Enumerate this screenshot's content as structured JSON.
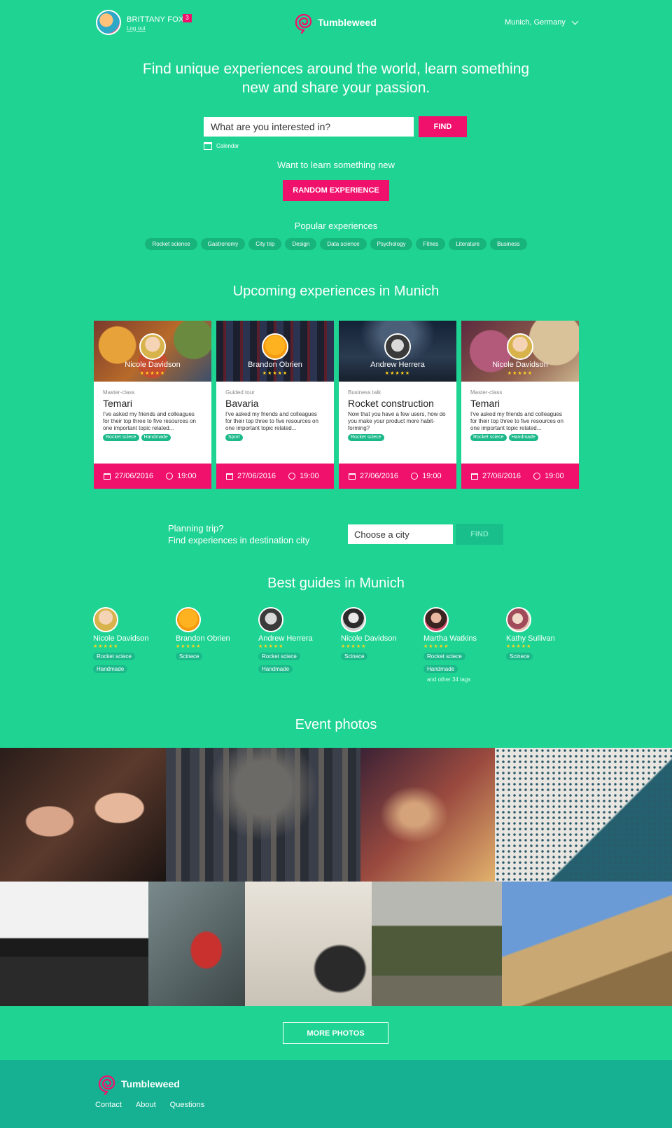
{
  "header": {
    "user_name": "BRITTANY FOX",
    "logout": "Log out",
    "notifications": "3",
    "brand": "Tumbleweed",
    "location": "Munich, Germany"
  },
  "hero": {
    "title": "Find unique experiences around the world, learn something new and share your passion.",
    "search_placeholder": "What are you interested in?",
    "find_label": "FIND",
    "calendar_label": "Calendar",
    "learn_text": "Want to learn something new",
    "random_label": "RANDOM EXPERIENCE",
    "popular_title": "Popular experiences",
    "tags": [
      "Rocket science",
      "Gastronomy",
      "City trip",
      "Design",
      "Data science",
      "Psychology",
      "Fitnes",
      "Literature",
      "Business"
    ]
  },
  "upcoming": {
    "title": "Upcoming experiences in Munich",
    "stars": "★★★★★",
    "cards": [
      {
        "host": "Nicole Davidson",
        "category": "Master-class",
        "title": "Temari",
        "desc": "I've asked my friends and colleagues for their top three to five resources on one important topic related...",
        "tags": [
          "Rocket sciece",
          "Handmade"
        ],
        "date": "27/06/2016",
        "time": "19:00"
      },
      {
        "host": "Brandon Obrien",
        "category": "Guided tour",
        "title": "Bavaria",
        "desc": "I've asked my friends and colleagues for their top three to five resources on one important topic related...",
        "tags": [
          "Sport"
        ],
        "date": "27/06/2016",
        "time": "19:00"
      },
      {
        "host": "Andrew Herrera",
        "category": "Business talk",
        "title": "Rocket construction",
        "desc": "Now that you have a few users, how do you make your product more habit-forming?",
        "tags": [
          "Rocket sciece"
        ],
        "date": "27/06/2016",
        "time": "19:00"
      },
      {
        "host": "Nicole Davidson",
        "category": "Master-class",
        "title": "Temari",
        "desc": "I've asked my friends and colleagues for their top three to five resources on one important topic related...",
        "tags": [
          "Rocket sciece",
          "Handmade"
        ],
        "date": "27/06/2016",
        "time": "19:00"
      }
    ]
  },
  "planning": {
    "line1": "Planning trip?",
    "line2": "Find experiences in destination city",
    "city_placeholder": "Choose a city",
    "find_label": "FIND"
  },
  "guides": {
    "title": "Best guides in Munich",
    "stars": "★★★★★",
    "items": [
      {
        "name": "Nicole Davidson",
        "tags": [
          "Rocket sciece",
          "Handmade"
        ],
        "more": ""
      },
      {
        "name": "Brandon Obrien",
        "tags": [
          "Scinece"
        ],
        "more": ""
      },
      {
        "name": "Andrew Herrera",
        "tags": [
          "Rocket sciece",
          "Handmade"
        ],
        "more": ""
      },
      {
        "name": "Nicole Davidson",
        "tags": [
          "Scinece"
        ],
        "more": ""
      },
      {
        "name": "Martha Watkins",
        "tags": [
          "Rocket sciece",
          "Handmade"
        ],
        "more": "and other 34 tags"
      },
      {
        "name": "Kathy Sullivan",
        "tags": [
          "Scinece"
        ],
        "more": ""
      }
    ]
  },
  "photos": {
    "title": "Event photos",
    "more_label": "MORE PHOTOS"
  },
  "footer": {
    "brand": "Tumbleweed",
    "links": [
      "Contact",
      "About",
      "Questions"
    ]
  },
  "colors": {
    "background": "#1fd493",
    "accent": "#f0116d",
    "footer": "#15b192",
    "stars": "#ffd31c"
  }
}
